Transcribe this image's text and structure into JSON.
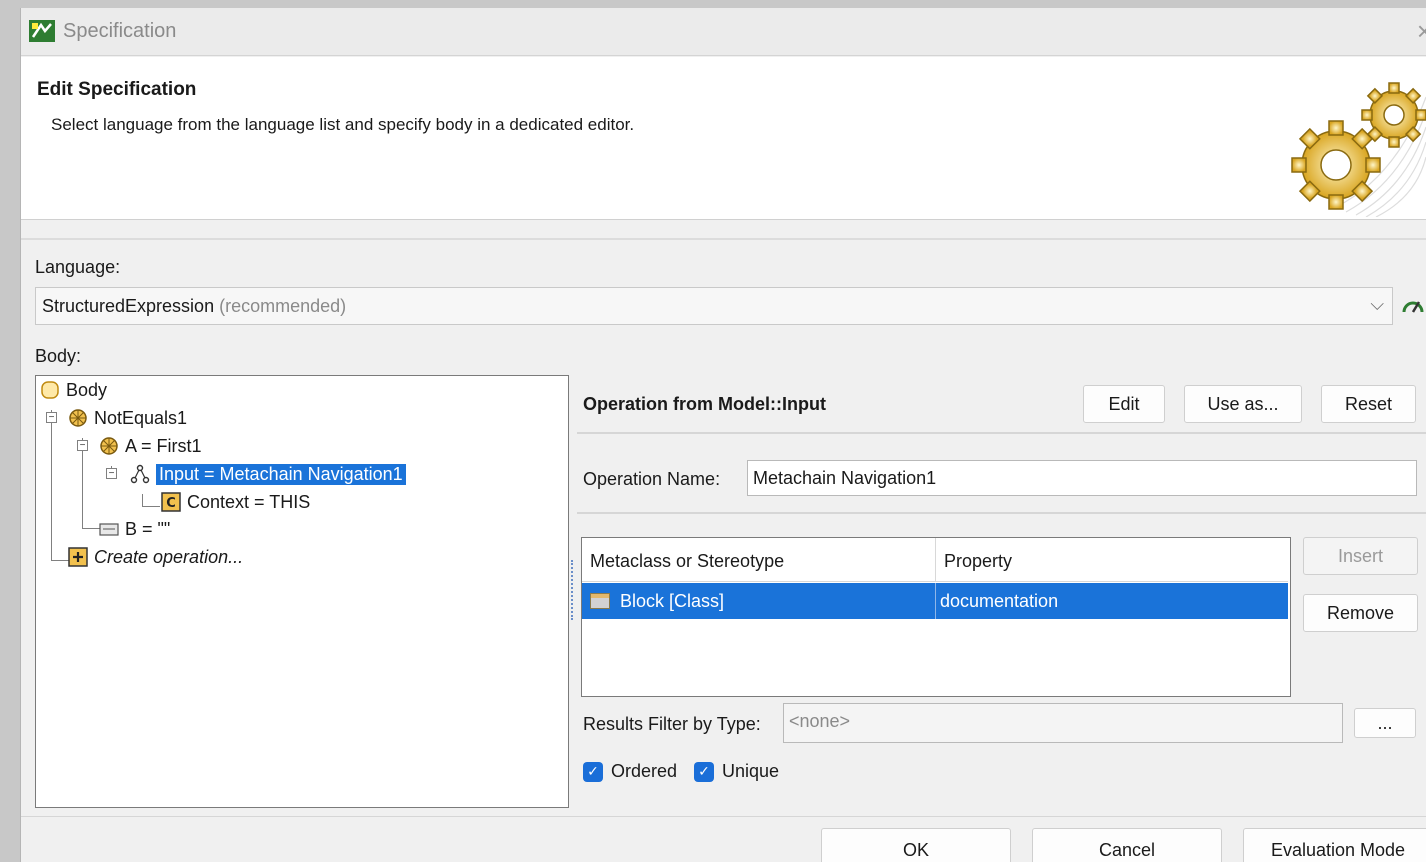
{
  "window": {
    "title": "Specification",
    "close_icon": "×"
  },
  "header": {
    "title": "Edit Specification",
    "description": "Select language from the language list and specify body in a dedicated editor."
  },
  "language": {
    "label": "Language:",
    "value": "StructuredExpression",
    "suffix": "(recommended)"
  },
  "body": {
    "label": "Body:",
    "tree": {
      "root": "Body",
      "not_equals": "NotEquals1",
      "a": "A = First1",
      "input": "Input = Metachain Navigation1",
      "context": "Context = THIS",
      "b": "B = \"\"",
      "create": "Create operation..."
    }
  },
  "operation": {
    "header": "Operation from Model::Input",
    "buttons": {
      "edit": "Edit",
      "use_as": "Use as...",
      "reset": "Reset"
    },
    "name_label": "Operation Name:",
    "name_value": "Metachain Navigation1",
    "table": {
      "columns": [
        "Metaclass or Stereotype",
        "Property"
      ],
      "rows": [
        {
          "metaclass": "Block [Class]",
          "property": "documentation"
        }
      ]
    },
    "insert": "Insert",
    "remove": "Remove",
    "filter_label": "Results Filter by Type:",
    "filter_value": "<none>",
    "filter_button": "...",
    "ordered": "Ordered",
    "unique": "Unique"
  },
  "footer": {
    "ok": "OK",
    "cancel": "Cancel",
    "evaluation": "Evaluation Mode"
  },
  "colors": {
    "selection": "#1a73d9",
    "checkbox": "#1a6ed8",
    "gear": "#d9a520"
  }
}
